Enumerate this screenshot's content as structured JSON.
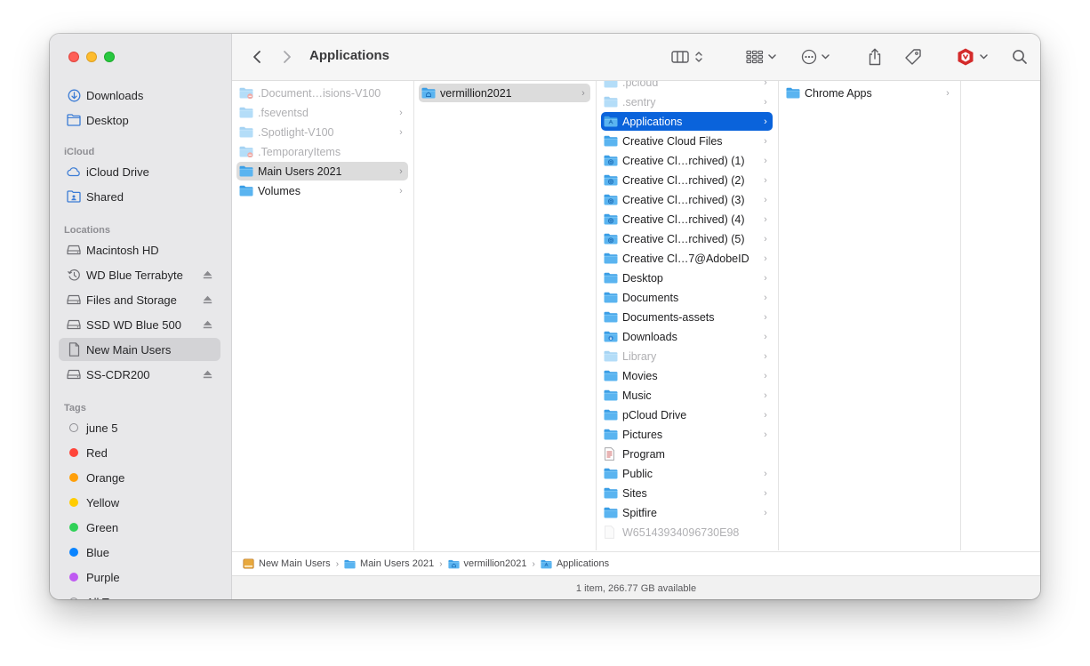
{
  "window": {
    "title": "Applications"
  },
  "toolbar": {
    "title": "Applications",
    "buttons": [
      "back-icon",
      "forward-icon",
      "column-view-icon",
      "group-by-icon",
      "more-actions-icon",
      "share-icon",
      "tag-icon",
      "extension-shield-icon",
      "search-icon"
    ]
  },
  "sidebar": {
    "favorites": [
      {
        "label": "Downloads",
        "icon": "downloads-icon"
      },
      {
        "label": "Desktop",
        "icon": "desktop-icon"
      }
    ],
    "icloud_title": "iCloud",
    "icloud": [
      {
        "label": "iCloud Drive",
        "icon": "icloud-icon"
      },
      {
        "label": "Shared",
        "icon": "shared-folder-icon"
      }
    ],
    "locations_title": "Locations",
    "locations": [
      {
        "label": "Macintosh HD",
        "icon": "disk-icon",
        "eject": false
      },
      {
        "label": "WD Blue Terrabyte",
        "icon": "time-machine-icon",
        "eject": true
      },
      {
        "label": "Files and Storage",
        "icon": "disk-icon",
        "eject": true
      },
      {
        "label": "SSD WD Blue 500",
        "icon": "disk-icon",
        "eject": true
      },
      {
        "label": "New Main Users",
        "icon": "document-icon",
        "eject": false,
        "selected": true
      },
      {
        "label": "SS-CDR200",
        "icon": "disk-icon",
        "eject": true
      }
    ],
    "tags_title": "Tags",
    "tags": [
      {
        "label": "june 5",
        "color": "none"
      },
      {
        "label": "Red",
        "color": "#ff453a"
      },
      {
        "label": "Orange",
        "color": "#ff9f0a"
      },
      {
        "label": "Yellow",
        "color": "#ffcc00"
      },
      {
        "label": "Green",
        "color": "#30d158"
      },
      {
        "label": "Blue",
        "color": "#0a84ff"
      },
      {
        "label": "Purple",
        "color": "#bf5af2"
      },
      {
        "label": "All T...",
        "color": "all"
      }
    ]
  },
  "columns": {
    "col1": [
      {
        "name": ".Document…isions-V100",
        "dim": true,
        "chevron": false,
        "icon": "restricted-folder"
      },
      {
        "name": ".fseventsd",
        "dim": true,
        "chevron": true,
        "icon": "folder"
      },
      {
        "name": ".Spotlight-V100",
        "dim": true,
        "chevron": true,
        "icon": "folder"
      },
      {
        "name": ".TemporaryItems",
        "dim": true,
        "chevron": false,
        "icon": "restricted-folder"
      },
      {
        "name": "Main Users 2021",
        "dim": false,
        "chevron": true,
        "icon": "folder",
        "selected": "gray"
      },
      {
        "name": "Volumes",
        "dim": false,
        "chevron": true,
        "icon": "folder"
      }
    ],
    "col2": [
      {
        "name": "vermillion2021",
        "dim": false,
        "chevron": true,
        "icon": "home-folder",
        "selected": "gray"
      }
    ],
    "col3": [
      {
        "name": ".pcloud",
        "dim": true,
        "chevron": true,
        "icon": "folder"
      },
      {
        "name": ".sentry",
        "dim": true,
        "chevron": true,
        "icon": "folder"
      },
      {
        "name": "Applications",
        "dim": false,
        "chevron": true,
        "icon": "apps-folder",
        "selected": "blue"
      },
      {
        "name": "Creative Cloud Files",
        "dim": false,
        "chevron": true,
        "icon": "folder"
      },
      {
        "name": "Creative Cl…rchived) (1)",
        "dim": false,
        "chevron": true,
        "icon": "cloud-folder"
      },
      {
        "name": "Creative Cl…rchived) (2)",
        "dim": false,
        "chevron": true,
        "icon": "cloud-folder"
      },
      {
        "name": "Creative Cl…rchived) (3)",
        "dim": false,
        "chevron": true,
        "icon": "cloud-folder"
      },
      {
        "name": "Creative Cl…rchived) (4)",
        "dim": false,
        "chevron": true,
        "icon": "cloud-folder"
      },
      {
        "name": "Creative Cl…rchived) (5)",
        "dim": false,
        "chevron": true,
        "icon": "cloud-folder"
      },
      {
        "name": "Creative Cl…7@AdobeID",
        "dim": false,
        "chevron": true,
        "icon": "folder"
      },
      {
        "name": "Desktop",
        "dim": false,
        "chevron": true,
        "icon": "folder"
      },
      {
        "name": "Documents",
        "dim": false,
        "chevron": true,
        "icon": "folder"
      },
      {
        "name": "Documents-assets",
        "dim": false,
        "chevron": true,
        "icon": "folder"
      },
      {
        "name": "Downloads",
        "dim": false,
        "chevron": true,
        "icon": "downloads-folder"
      },
      {
        "name": "Library",
        "dim": true,
        "chevron": true,
        "icon": "folder"
      },
      {
        "name": "Movies",
        "dim": false,
        "chevron": true,
        "icon": "folder"
      },
      {
        "name": "Music",
        "dim": false,
        "chevron": true,
        "icon": "folder"
      },
      {
        "name": "pCloud Drive",
        "dim": false,
        "chevron": true,
        "icon": "folder"
      },
      {
        "name": "Pictures",
        "dim": false,
        "chevron": true,
        "icon": "folder"
      },
      {
        "name": "Program",
        "dim": false,
        "chevron": false,
        "icon": "file"
      },
      {
        "name": "Public",
        "dim": false,
        "chevron": true,
        "icon": "folder"
      },
      {
        "name": "Sites",
        "dim": false,
        "chevron": true,
        "icon": "folder"
      },
      {
        "name": "Spitfire",
        "dim": false,
        "chevron": true,
        "icon": "folder"
      },
      {
        "name": "W65143934096730E98",
        "dim": true,
        "chevron": false,
        "icon": "blank-file"
      }
    ],
    "col4": [
      {
        "name": "Chrome Apps",
        "dim": false,
        "chevron": true,
        "icon": "folder"
      }
    ]
  },
  "pathbar": [
    {
      "label": "New Main Users",
      "icon": "drive-icon"
    },
    {
      "label": "Main Users 2021",
      "icon": "folder-icon"
    },
    {
      "label": "vermillion2021",
      "icon": "home-folder-icon"
    },
    {
      "label": "Applications",
      "icon": "apps-folder-icon"
    }
  ],
  "status": {
    "text": "1 item, 266.77 GB available"
  },
  "colors": {
    "accent": "#0a63db",
    "folder": "#5ab4f0",
    "sidebar": "#e8e8ea"
  }
}
